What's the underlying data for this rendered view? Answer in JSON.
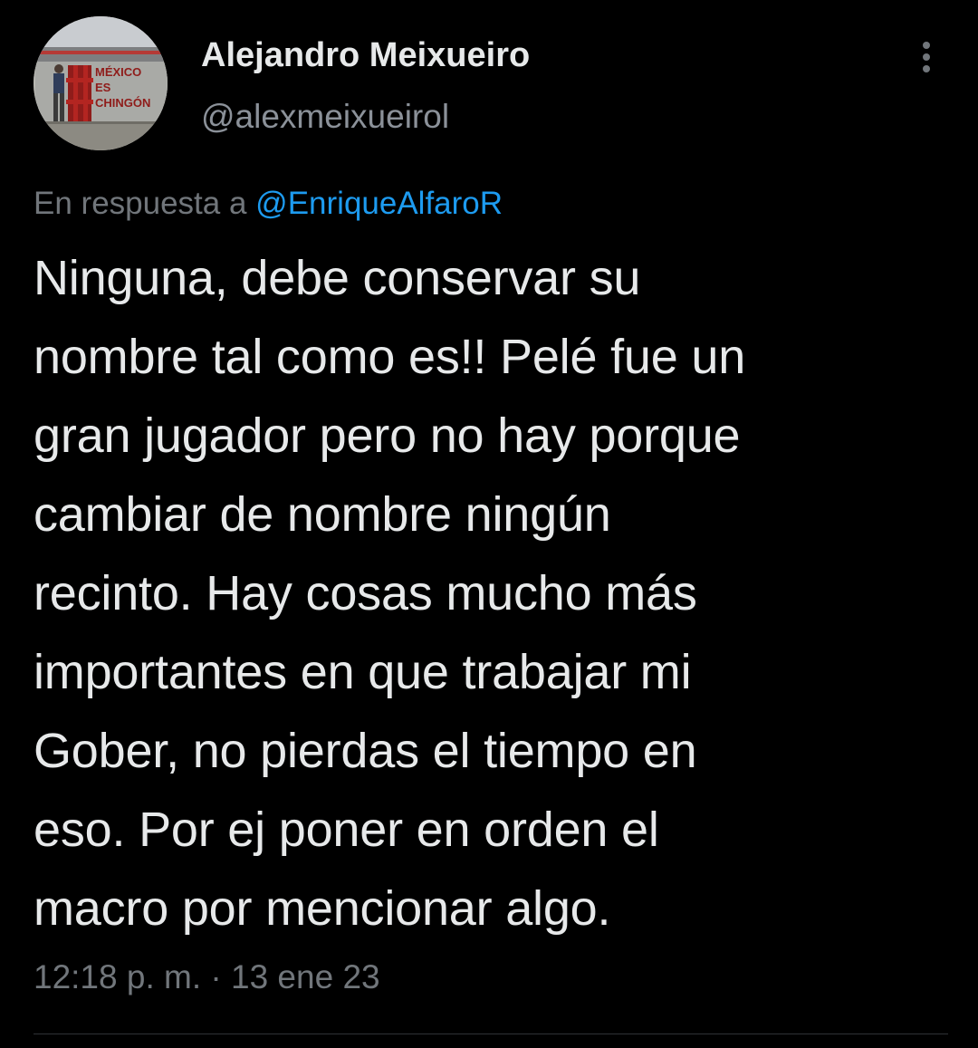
{
  "author": {
    "display_name": "Alejandro Meixueiro",
    "handle": "@alexmeixueirol",
    "avatar_sign_text": [
      "MÉXICO",
      "ES",
      "CHINGÓN"
    ],
    "avatar_icon": "profile-photo"
  },
  "reply": {
    "prefix": "En respuesta a",
    "mention": "@EnriqueAlfaroR"
  },
  "tweet": {
    "text_lines": [
      "Ninguna, debe conservar su",
      "nombre tal como es!! Pelé fue un",
      "gran jugador pero no hay porque",
      "cambiar de nombre ningún",
      "recinto. Hay cosas mucho más",
      "importantes en que trabajar mi",
      "Gober, no pierdas el tiempo en",
      "eso. Por ej poner en orden el",
      "macro por mencionar algo."
    ],
    "time": "12:18 p. m.",
    "separator": "·",
    "date": "13 ene 23"
  },
  "icons": {
    "more": "more-vertical-icon"
  },
  "colors": {
    "background": "#000000",
    "primary_text": "#e7e9ea",
    "secondary_text": "#71767b",
    "link": "#1d9bf0",
    "divider": "#2f3336"
  }
}
